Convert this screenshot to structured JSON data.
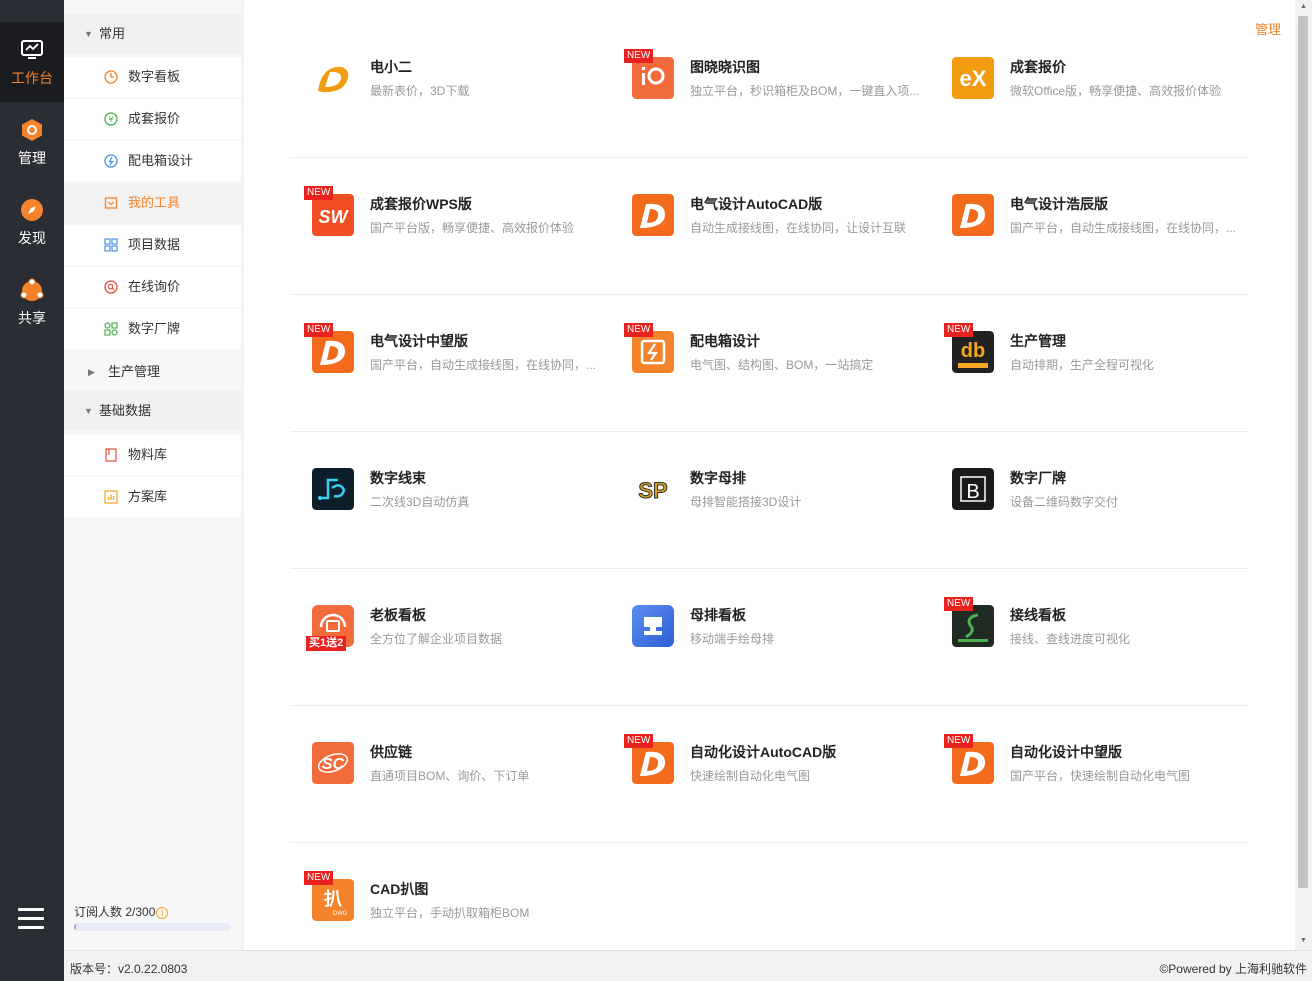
{
  "rail": {
    "workbench": "工作台",
    "manage": "管理",
    "discover": "发现",
    "share": "共享"
  },
  "sidebar": {
    "group_common": "常用",
    "items_common": [
      "数字看板",
      "成套报价",
      "配电箱设计",
      "我的工具",
      "项目数据",
      "在线询价",
      "数字厂牌"
    ],
    "group_production": "生产管理",
    "group_basic": "基础数据",
    "items_basic": [
      "物料库",
      "方案库"
    ],
    "subscribers_label": "订阅人数 2/300",
    "subscribers_info_icon": "i",
    "subscribers_fraction": 0.0067
  },
  "main": {
    "manage_link": "管理",
    "badge_new": "NEW",
    "badge_promo": "买1送2",
    "tools": [
      {
        "name": "电小二",
        "desc": "最新表价，3D下载"
      },
      {
        "name": "图晓晓识图",
        "desc": "独立平台，秒识箱柜及BOM，一键直入项..."
      },
      {
        "name": "成套报价",
        "desc": "微软Office版，畅享便捷、高效报价体验"
      },
      {
        "name": "成套报价WPS版",
        "desc": "国产平台版，畅享便捷、高效报价体验"
      },
      {
        "name": "电气设计AutoCAD版",
        "desc": "自动生成接线图，在线协同，让设计互联"
      },
      {
        "name": "电气设计浩辰版",
        "desc": "国产平台，自动生成接线图，在线协同，..."
      },
      {
        "name": "电气设计中望版",
        "desc": "国产平台，自动生成接线图，在线协同，..."
      },
      {
        "name": "配电箱设计",
        "desc": "电气图、结构图、BOM，一站搞定"
      },
      {
        "name": "生产管理",
        "desc": "自动排期，生产全程可视化"
      },
      {
        "name": "数字线束",
        "desc": "二次线3D自动仿真"
      },
      {
        "name": "数字母排",
        "desc": "母排智能搭接3D设计"
      },
      {
        "name": "数字厂牌",
        "desc": "设备二维码数字交付"
      },
      {
        "name": "老板看板",
        "desc": "全方位了解企业项目数据"
      },
      {
        "name": "母排看板",
        "desc": "移动端手绘母排"
      },
      {
        "name": "接线看板",
        "desc": "接线、查线进度可视化"
      },
      {
        "name": "供应链",
        "desc": "直通项目BOM、询价、下订单"
      },
      {
        "name": "自动化设计AutoCAD版",
        "desc": "快速绘制自动化电气图"
      },
      {
        "name": "自动化设计中望版",
        "desc": "国产平台，快速绘制自动化电气图"
      },
      {
        "name": "CAD扒图",
        "desc": "独立平台，手动扒取箱柜BOM"
      }
    ],
    "logo_text": {
      "ex": "eX",
      "sw": "SW",
      "sc": "SC",
      "db": "db",
      "b": "B",
      "sp": "SP",
      "pa": "扒",
      "ps": "DWG"
    }
  },
  "footer": {
    "version": "版本号：v2.0.22.0803",
    "powered": "©Powered by 上海利驰软件"
  },
  "colors": {
    "accent": "#f5832b",
    "rail_bg": "#2a2d33",
    "badge": "#e8231f"
  }
}
